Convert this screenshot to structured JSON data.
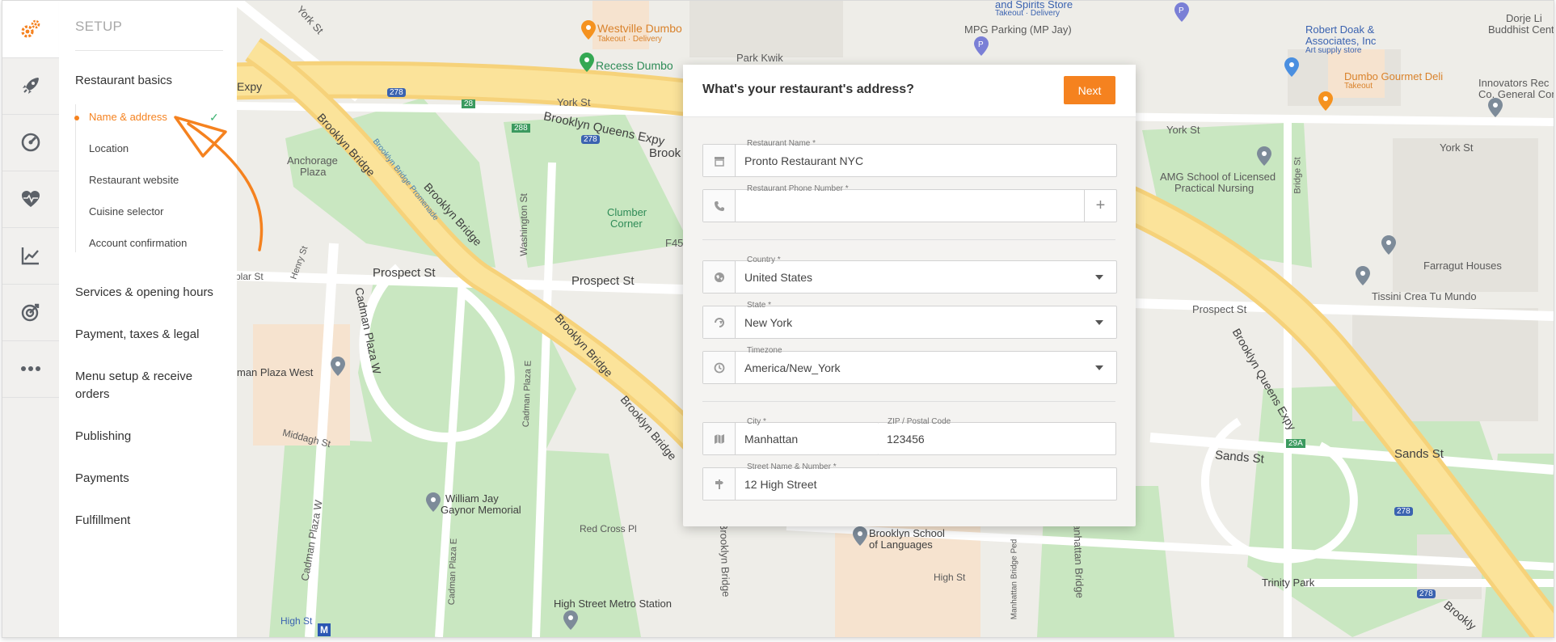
{
  "colors": {
    "accent": "#f5821f",
    "check": "#3cb371"
  },
  "rail": {
    "icons": [
      "gears-icon",
      "rocket-icon",
      "compass-icon",
      "heartbeat-icon",
      "chart-icon",
      "target-icon",
      "more-icon"
    ]
  },
  "sidebar": {
    "title": "SETUP",
    "sections": [
      {
        "label": "Restaurant basics"
      },
      {
        "label": "Services & opening hours"
      },
      {
        "label": "Payment, taxes & legal"
      },
      {
        "label": "Menu setup & receive orders"
      },
      {
        "label": "Publishing"
      },
      {
        "label": "Payments"
      },
      {
        "label": "Fulfillment"
      }
    ],
    "sub_items": [
      {
        "label": "Name & address",
        "state": "active-completed"
      },
      {
        "label": "Location"
      },
      {
        "label": "Restaurant website"
      },
      {
        "label": "Cuisine selector"
      },
      {
        "label": "Account confirmation"
      }
    ]
  },
  "modal": {
    "title": "What's your restaurant's address?",
    "next_label": "Next",
    "fields": {
      "name": {
        "label": "Restaurant Name *",
        "value": "Pronto Restaurant NYC",
        "icon": "store-icon"
      },
      "phone": {
        "label": "Restaurant Phone Number *",
        "value": "",
        "icon": "phone-icon",
        "action": "+"
      },
      "country": {
        "label": "Country *",
        "value": "United States",
        "icon": "globe-icon"
      },
      "state": {
        "label": "State *",
        "value": "New York",
        "icon": "state-icon"
      },
      "timezone": {
        "label": "Timezone",
        "value": "America/New_York",
        "icon": "timezone-icon"
      },
      "city": {
        "label": "City *",
        "value": "Manhattan",
        "icon": "map-icon"
      },
      "zip": {
        "label": "ZIP / Postal Code",
        "value": "123456"
      },
      "street": {
        "label": "Street Name & Number *",
        "value": "12 High Street",
        "icon": "signpost-icon"
      }
    }
  },
  "map": {
    "labels": [
      "York St",
      "Westville Dumbo",
      "Takeout · Delivery",
      "Recess Dumbo",
      "and Spirits Store",
      "Takeout · Delivery",
      "MPG Parking (MP Jay)",
      "Park Kwik",
      "Robert Doak &",
      "Associates, Inc",
      "Art supply store",
      "Dumbo Gourmet Deli",
      "Takeout",
      "Dorje Li",
      "Buddhist Cent",
      "Innovators Rec",
      "Co. General Cor",
      "Expy",
      "278",
      "28",
      "York St",
      "Brooklyn Queens Expy",
      "288",
      "278",
      "Brook",
      "Anchorage",
      "Plaza",
      "Brooklyn Bridge",
      "Brooklyn Bridge Promenade",
      "Brooklyn Bridge",
      "Washington St",
      "Clumber",
      "Corner",
      "F45",
      "York St",
      "York St",
      "AMG School of Licensed",
      "Practical Nursing",
      "Bridge St",
      "Farragut Houses",
      "Tissini Crea Tu Mundo",
      "Prospect St",
      "Prospect St",
      "Prospect St",
      "Henry St",
      "plar St",
      "Cadman Plaza W",
      "Brooklyn Bridge",
      "Brooklyn Queens Expy",
      "man Plaza West",
      "Cadman Plaza E",
      "Brooklyn Bridge",
      "Middagh St",
      "Sands St",
      "Sands St",
      "29A",
      "278",
      "William Jay",
      "Gaynor Memorial",
      "Red Cross Pl",
      "Brooklyn Bridge",
      "Brooklyn School",
      "of Languages",
      "Manhattan Bridge",
      "Cadman Plaza W",
      "Cadman Plaza E",
      "High St",
      "High Street Metro Station",
      "High St",
      "Manhattan Bridge Ped",
      "Trinity Park",
      "278",
      "Brookly"
    ]
  }
}
